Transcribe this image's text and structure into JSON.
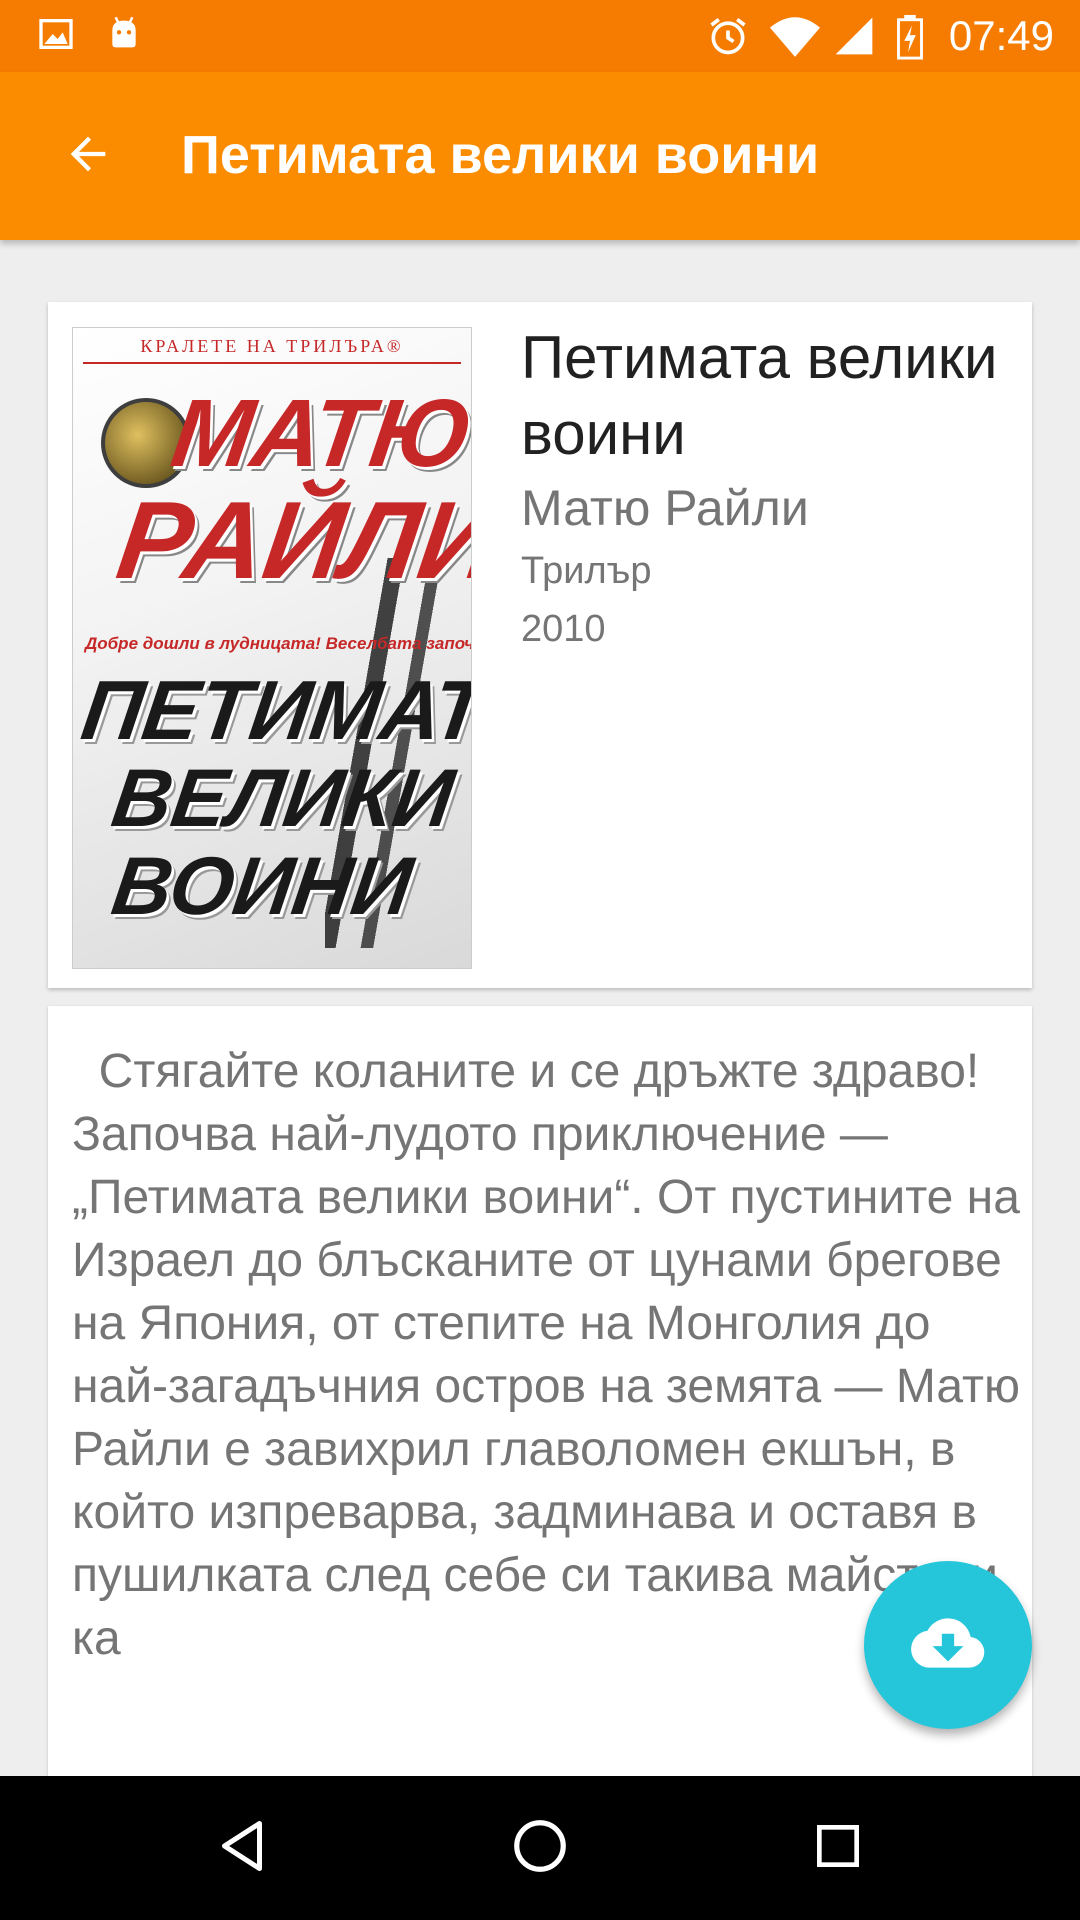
{
  "status_bar": {
    "time": "07:49",
    "icons": [
      "image-icon",
      "android-icon",
      "alarm-icon",
      "wifi-icon",
      "signal-icon",
      "battery-charging-icon"
    ]
  },
  "app_bar": {
    "title": "Петимата велики воини",
    "back_icon": "arrow-back-icon",
    "color": "#fb8c00"
  },
  "book": {
    "title": "Петимата велики воини",
    "author": "Матю Райли",
    "genre": "Трилър",
    "year": "2010",
    "cover": {
      "series": "КРАЛЕТЕ НА ТРИЛЪРА®",
      "author_line1": "МАТЮ",
      "author_line2": "РАЙЛИ",
      "tagline": "Добре дошли в лудницата! Веселбата започва!",
      "title_line1": "ПЕТИМАТА",
      "title_line2": "ВЕЛИКИ",
      "title_line3": "ВОИНИ"
    }
  },
  "description": {
    "text": "  Стягайте коланите и се дръжте здраво! Започва най-лудото приключение — „Петимата велики воини“. От пустините на Израел до блъсканите от цунами брегове на Япония, от степите на Монголия до най-загадъчния остров на земята — Матю Райли е завихрил главоломен екшън, в който изпреварва, задминава и оставя в пушилката след себе си такива майстори ка"
  },
  "fab": {
    "icon": "cloud-download-icon",
    "color": "#26c6da"
  },
  "nav_bar": {
    "icons": [
      "back-triangle-icon",
      "home-circle-icon",
      "recents-square-icon"
    ]
  }
}
